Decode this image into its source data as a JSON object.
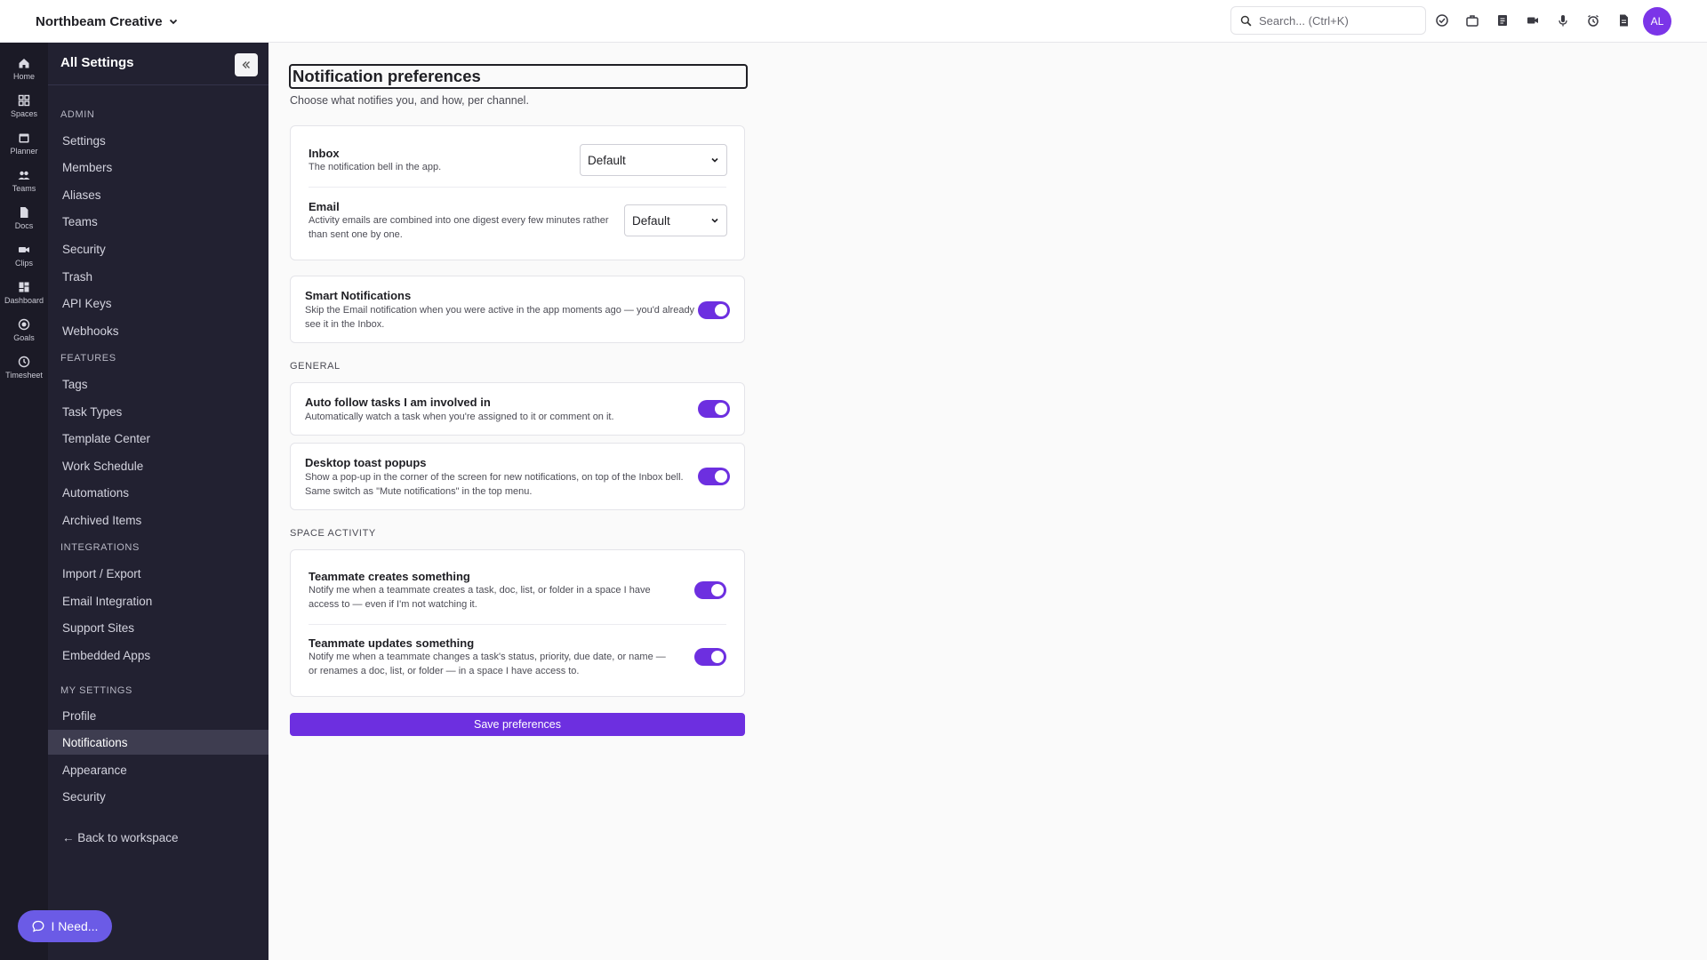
{
  "workspace": {
    "name": "Northbeam Creative"
  },
  "search": {
    "placeholder": "Search... (Ctrl+K)"
  },
  "topbar": {
    "icons": [
      "check-circle-icon",
      "briefcase-icon",
      "notepad-icon",
      "video-icon",
      "mic-icon",
      "alarm-icon",
      "document-icon"
    ],
    "avatar_initials": "AL",
    "avatar_color": "#7b35e8"
  },
  "rail": {
    "items": [
      {
        "label": "Home",
        "icon": "home-icon"
      },
      {
        "label": "Spaces",
        "icon": "grid-icon"
      },
      {
        "label": "Planner",
        "icon": "calendar-icon"
      },
      {
        "label": "Teams",
        "icon": "people-icon"
      },
      {
        "label": "Docs",
        "icon": "doc-icon"
      },
      {
        "label": "Clips",
        "icon": "video-icon"
      },
      {
        "label": "Dashboard",
        "icon": "dashboard-icon"
      },
      {
        "label": "Goals",
        "icon": "target-icon"
      },
      {
        "label": "Timesheet",
        "icon": "clock-icon"
      }
    ]
  },
  "sidebar": {
    "title": "All Settings",
    "sections": [
      {
        "label": "ADMIN",
        "items": [
          "Settings",
          "Members",
          "Aliases",
          "Teams",
          "Security",
          "Trash",
          "API Keys",
          "Webhooks"
        ]
      },
      {
        "label": "FEATURES",
        "items": [
          "Tags",
          "Task Types",
          "Template Center",
          "Work Schedule",
          "Automations",
          "Archived Items"
        ]
      },
      {
        "label": "INTEGRATIONS",
        "items": [
          "Import / Export",
          "Email Integration",
          "Support Sites",
          "Embedded Apps"
        ]
      },
      {
        "label": "MY SETTINGS",
        "items": [
          "Profile",
          "Notifications",
          "Appearance",
          "Security"
        ]
      }
    ],
    "active_item": "Notifications",
    "back_link": "← Back to workspace",
    "help_button": "I Need..."
  },
  "main": {
    "title": "Notification preferences",
    "subtitle": "Choose what notifies you, and how, per channel.",
    "channels": [
      {
        "title": "Inbox",
        "desc": "The notification bell in the app.",
        "value": "Default"
      },
      {
        "title": "Email",
        "desc": "Activity emails are combined into one digest every few minutes rather than sent one by one.",
        "value": "Default"
      }
    ],
    "smart": {
      "title": "Smart Notifications",
      "desc": "Skip the Email notification when you were active in the app moments ago — you'd already see it in the Inbox.",
      "on": true
    },
    "general_label": "GENERAL",
    "general": [
      {
        "title": "Auto follow tasks I am involved in",
        "desc": "Automatically watch a task when you're assigned to it or comment on it.",
        "on": true
      },
      {
        "title": "Desktop toast popups",
        "desc": "Show a pop-up in the corner of the screen for new notifications, on top of the Inbox bell. Same switch as \"Mute notifications\" in the top menu.",
        "on": true
      }
    ],
    "space_label": "SPACE ACTIVITY",
    "space": [
      {
        "title": "Teammate creates something",
        "desc": "Notify me when a teammate creates a task, doc, list, or folder in a space I have access to — even if I'm not watching it.",
        "on": true
      },
      {
        "title": "Teammate updates something",
        "desc": "Notify me when a teammate changes a task's status, priority, due date, or name — or renames a doc, list, or folder — in a space I have access to.",
        "on": true
      }
    ],
    "save_label": "Save preferences",
    "accent_color": "#6d2fe0"
  }
}
